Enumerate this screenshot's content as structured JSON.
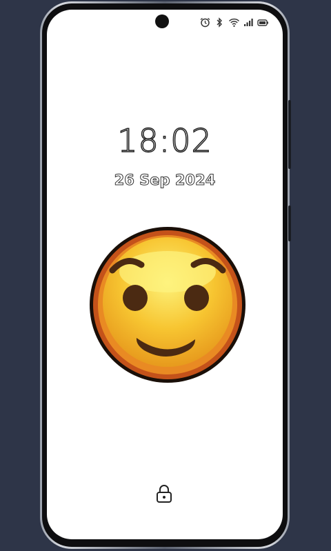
{
  "lockscreen": {
    "time": "18:02",
    "date": "26 Sep 2024"
  },
  "status_bar": {
    "icons": [
      "alarm-icon",
      "bluetooth-icon",
      "wifi-icon",
      "signal-icon",
      "battery-icon"
    ]
  },
  "wallpaper": {
    "icon": "smiling-face-emoji",
    "colors": {
      "face": "#f7c531",
      "face_highlight": "#fdf27a",
      "rim": "#c4521a",
      "features": "#4b2a12"
    }
  },
  "background_color": "#2e3548"
}
